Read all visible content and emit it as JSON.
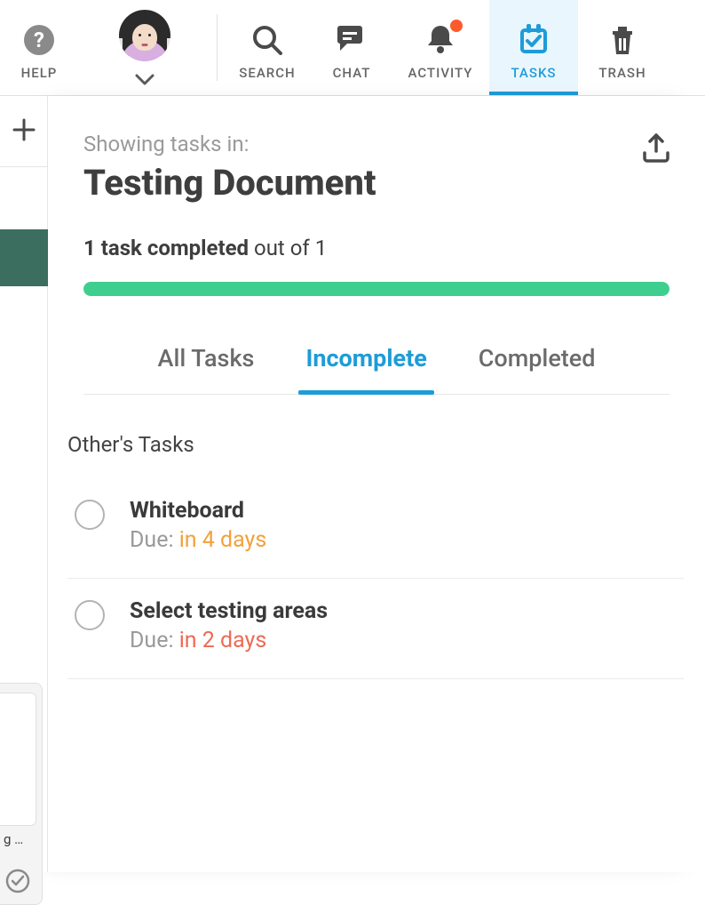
{
  "toolbar": {
    "help_label": "HELP",
    "search_label": "SEARCH",
    "chat_label": "CHAT",
    "activity_label": "ACTIVITY",
    "tasks_label": "TASKS",
    "trash_label": "TRASH"
  },
  "left": {
    "card_caption": "g …"
  },
  "panel": {
    "showing_label": "Showing tasks in:",
    "document_title": "Testing Document",
    "progress_prefix": "1 task completed",
    "progress_suffix": " out of 1",
    "tabs": {
      "all": "All Tasks",
      "incomplete": "Incomplete",
      "completed": "Completed"
    },
    "section_title": "Other's Tasks",
    "tasks": [
      {
        "title": "Whiteboard",
        "due_label": "Due: ",
        "due_value": "in 4 days",
        "due_class": "due-orange"
      },
      {
        "title": "Select testing areas",
        "due_label": "Due: ",
        "due_value": "in 2 days",
        "due_class": "due-red"
      }
    ]
  }
}
